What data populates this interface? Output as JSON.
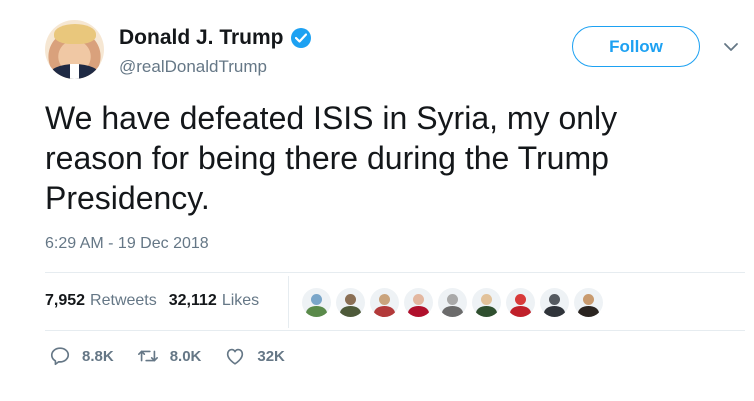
{
  "author": {
    "display_name": "Donald J. Trump",
    "handle": "@realDonaldTrump",
    "verified": true
  },
  "follow_button": {
    "label": "Follow"
  },
  "tweet": {
    "text": "We have defeated ISIS in Syria, my only reason for being there during the Trump Presidency.",
    "timestamp": "6:29 AM - 19 Dec 2018"
  },
  "stats": {
    "retweets": {
      "count": "7,952",
      "label": "Retweets"
    },
    "likes": {
      "count": "32,112",
      "label": "Likes"
    }
  },
  "liker_avatars": [
    {
      "icon": "user-avatar-icon",
      "color": "#7aa6c9",
      "body": "#5a8a4a"
    },
    {
      "icon": "user-avatar-icon",
      "color": "#8a6f55",
      "body": "#4e5a3a"
    },
    {
      "icon": "user-avatar-icon",
      "color": "#c9a37c",
      "body": "#b33a3a"
    },
    {
      "icon": "user-avatar-icon",
      "color": "#e3b7a0",
      "body": "#b0102c"
    },
    {
      "icon": "user-avatar-icon",
      "color": "#a9a9a9",
      "body": "#6b6b6b"
    },
    {
      "icon": "user-avatar-icon",
      "color": "#e2c29a",
      "body": "#2f4f2f"
    },
    {
      "icon": "user-avatar-icon",
      "color": "#d83a3a",
      "body": "#c0202a"
    },
    {
      "icon": "user-avatar-icon",
      "color": "#555a60",
      "body": "#30343a"
    },
    {
      "icon": "user-avatar-icon",
      "color": "#c89a6e",
      "body": "#2a2420"
    }
  ],
  "actions": {
    "replies": {
      "icon": "reply-icon",
      "count": "8.8K"
    },
    "retweets": {
      "icon": "retweet-icon",
      "count": "8.0K"
    },
    "likes": {
      "icon": "heart-icon",
      "count": "32K"
    }
  },
  "colors": {
    "accent": "#1da1f2",
    "secondary_text": "#657786",
    "divider": "#e6ecf0"
  }
}
